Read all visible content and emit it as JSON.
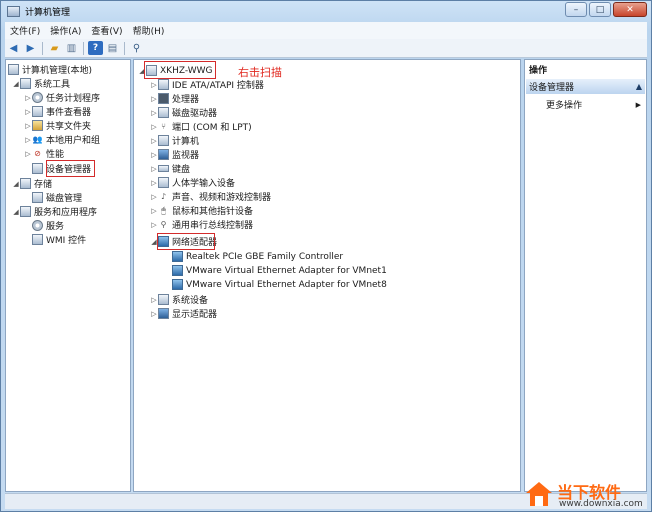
{
  "window": {
    "title": "计算机管理",
    "minimize": "–",
    "maximize": "□",
    "close": "✕"
  },
  "menu": [
    "文件(F)",
    "操作(A)",
    "查看(V)",
    "帮助(H)"
  ],
  "left_tree": [
    {
      "label": "计算机管理(本地)",
      "indent": 0,
      "arrow": ""
    },
    {
      "label": "系统工具",
      "indent": 1,
      "arrow": "◢"
    },
    {
      "label": "任务计划程序",
      "indent": 2,
      "arrow": "▷"
    },
    {
      "label": "事件查看器",
      "indent": 2,
      "arrow": "▷"
    },
    {
      "label": "共享文件夹",
      "indent": 2,
      "arrow": "▷"
    },
    {
      "label": "本地用户和组",
      "indent": 2,
      "arrow": "▷"
    },
    {
      "label": "性能",
      "indent": 2,
      "arrow": "▷"
    },
    {
      "label": "设备管理器",
      "indent": 2,
      "arrow": ""
    },
    {
      "label": "存储",
      "indent": 1,
      "arrow": "◢"
    },
    {
      "label": "磁盘管理",
      "indent": 2,
      "arrow": ""
    },
    {
      "label": "服务和应用程序",
      "indent": 1,
      "arrow": "◢"
    },
    {
      "label": "服务",
      "indent": 2,
      "arrow": ""
    },
    {
      "label": "WMI 控件",
      "indent": 2,
      "arrow": ""
    }
  ],
  "center_tree": [
    {
      "label": "XKHZ-WWG",
      "indent": 0,
      "arrow": "◢"
    },
    {
      "label": "IDE ATA/ATAPI 控制器",
      "indent": 1,
      "arrow": "▷"
    },
    {
      "label": "处理器",
      "indent": 1,
      "arrow": "▷"
    },
    {
      "label": "磁盘驱动器",
      "indent": 1,
      "arrow": "▷"
    },
    {
      "label": "端口 (COM 和 LPT)",
      "indent": 1,
      "arrow": "▷"
    },
    {
      "label": "计算机",
      "indent": 1,
      "arrow": "▷"
    },
    {
      "label": "监视器",
      "indent": 1,
      "arrow": "▷"
    },
    {
      "label": "键盘",
      "indent": 1,
      "arrow": "▷"
    },
    {
      "label": "人体学输入设备",
      "indent": 1,
      "arrow": "▷"
    },
    {
      "label": "声音、视频和游戏控制器",
      "indent": 1,
      "arrow": "▷"
    },
    {
      "label": "鼠标和其他指针设备",
      "indent": 1,
      "arrow": "▷"
    },
    {
      "label": "通用串行总线控制器",
      "indent": 1,
      "arrow": "▷"
    },
    {
      "label": "网络适配器",
      "indent": 1,
      "arrow": "◢"
    },
    {
      "label": "Realtek PCIe GBE Family Controller",
      "indent": 2,
      "arrow": ""
    },
    {
      "label": "VMware Virtual Ethernet Adapter for VMnet1",
      "indent": 2,
      "arrow": ""
    },
    {
      "label": "VMware Virtual Ethernet Adapter for VMnet8",
      "indent": 2,
      "arrow": ""
    },
    {
      "label": "系统设备",
      "indent": 1,
      "arrow": "▷"
    },
    {
      "label": "显示适配器",
      "indent": 1,
      "arrow": "▷"
    }
  ],
  "annotation": "右击扫描",
  "actions": {
    "title": "操作",
    "selected": "设备管理器",
    "more": "更多操作"
  },
  "watermark": {
    "top": "当下软件",
    "bottom": "www.downxia.com"
  }
}
